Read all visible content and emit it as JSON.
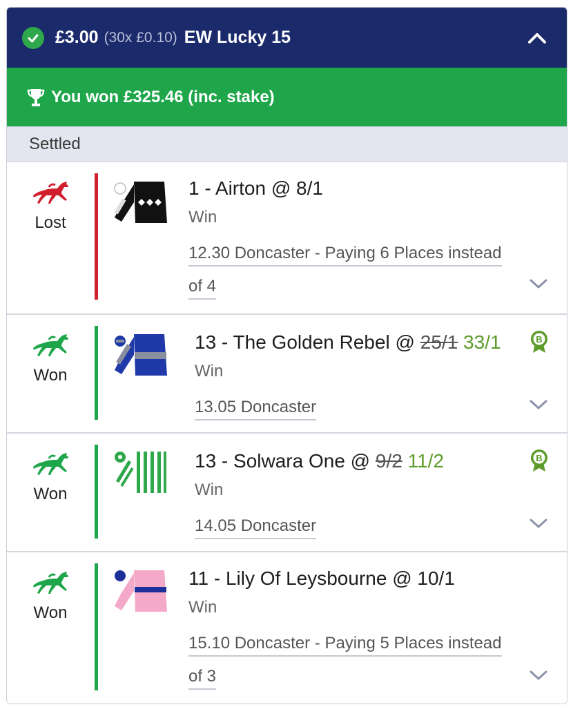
{
  "header": {
    "stake": "£3.00",
    "stake_detail": "(30x £0.10)",
    "bet_type": "EW Lucky 15"
  },
  "win_banner": {
    "text": "You won £325.46 (inc. stake)"
  },
  "status": "Settled",
  "colors": {
    "header_bg": "#1b2a6b",
    "win_green": "#1fa64b",
    "lost_red": "#d0202e",
    "odds_green": "#5c9b2a"
  },
  "selections": [
    {
      "result": "Lost",
      "title": "1 - Airton @ 8/1",
      "old_odds": "",
      "new_odds": "",
      "market": "Win",
      "race_line1": "12.30 Doncaster - Paying 6 Places instead",
      "race_line2": "of 4",
      "boost_icon": false
    },
    {
      "result": "Won",
      "title": "13 - The Golden Rebel @ ",
      "old_odds": "25/1",
      "new_odds": "33/1",
      "market": "Win",
      "race_line1": "13.05 Doncaster",
      "race_line2": "",
      "boost_icon": true
    },
    {
      "result": "Won",
      "title": "13 - Solwara One @ ",
      "old_odds": "9/2",
      "new_odds": "11/2",
      "market": "Win",
      "race_line1": "14.05 Doncaster",
      "race_line2": "",
      "boost_icon": true
    },
    {
      "result": "Won",
      "title": "11 - Lily Of Leysbourne @ 10/1",
      "old_odds": "",
      "new_odds": "",
      "market": "Win",
      "race_line1": "15.10 Doncaster - Paying 5 Places instead",
      "race_line2": "of 3",
      "boost_icon": false
    }
  ]
}
